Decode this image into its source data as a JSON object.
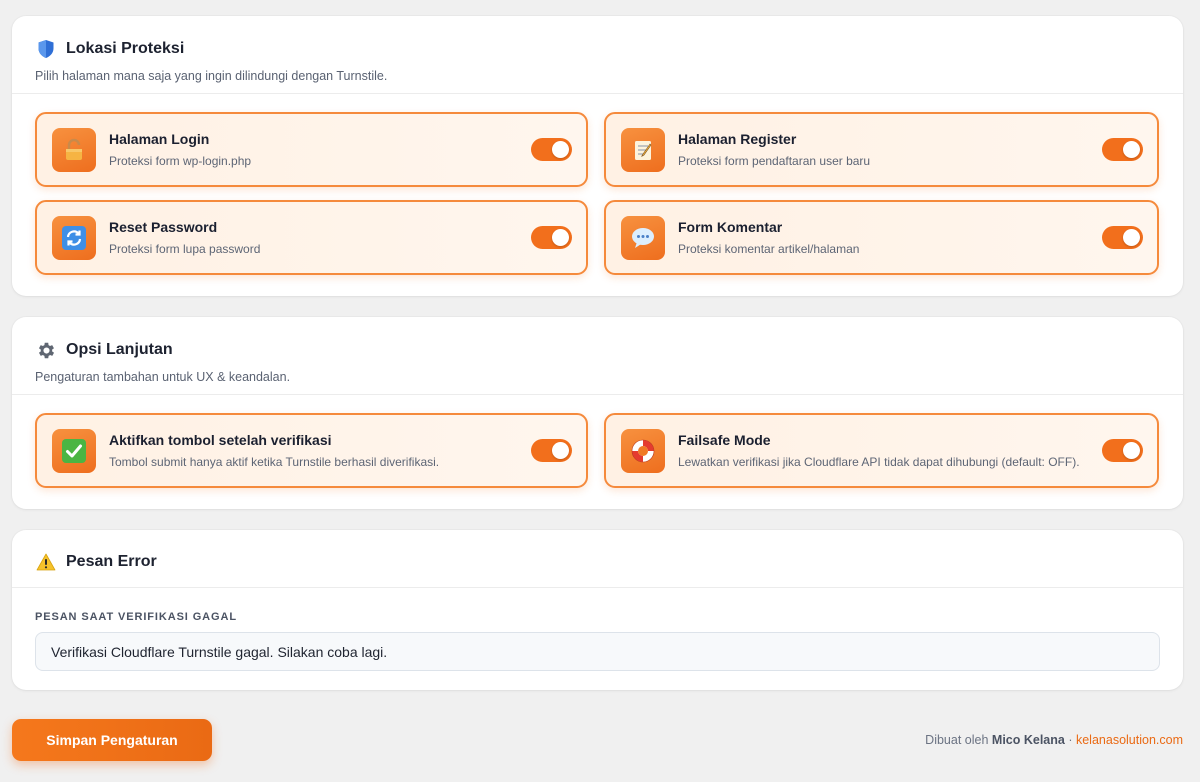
{
  "protection": {
    "title": "Lokasi Proteksi",
    "subtitle": "Pilih halaman mana saja yang ingin dilindungi dengan Turnstile.",
    "icon": "shield-icon",
    "options": [
      {
        "title": "Halaman Login",
        "desc": "Proteksi form wp-login.php",
        "icon": "lock-icon",
        "enabled": true
      },
      {
        "title": "Halaman Register",
        "desc": "Proteksi form pendaftaran user baru",
        "icon": "memo-icon",
        "enabled": true
      },
      {
        "title": "Reset Password",
        "desc": "Proteksi form lupa password",
        "icon": "refresh-icon",
        "enabled": true
      },
      {
        "title": "Form Komentar",
        "desc": "Proteksi komentar artikel/halaman",
        "icon": "speech-bubble-icon",
        "enabled": true
      }
    ]
  },
  "advanced": {
    "title": "Opsi Lanjutan",
    "subtitle": "Pengaturan tambahan untuk UX & keandalan.",
    "icon": "gear-icon",
    "options": [
      {
        "title": "Aktifkan tombol setelah verifikasi",
        "desc": "Tombol submit hanya aktif ketika Turnstile berhasil diverifikasi.",
        "icon": "checkmark-icon",
        "enabled": true
      },
      {
        "title": "Failsafe Mode",
        "desc": "Lewatkan verifikasi jika Cloudflare API tidak dapat dihubungi (default: OFF).",
        "icon": "lifebuoy-icon",
        "enabled": true
      }
    ]
  },
  "error": {
    "title": "Pesan Error",
    "icon": "warning-icon",
    "field_label": "PESAN SAAT VERIFIKASI GAGAL",
    "field_value": "Verifikasi Cloudflare Turnstile gagal. Silakan coba lagi."
  },
  "footer": {
    "save_label": "Simpan Pengaturan",
    "made_by": "Dibuat oleh",
    "author": "Mico Kelana",
    "separator": "·",
    "site": "kelanasolution.com"
  },
  "colors": {
    "accent": "#f26f1c",
    "card_border": "#f58a3c",
    "background": "#f0f0f0"
  }
}
